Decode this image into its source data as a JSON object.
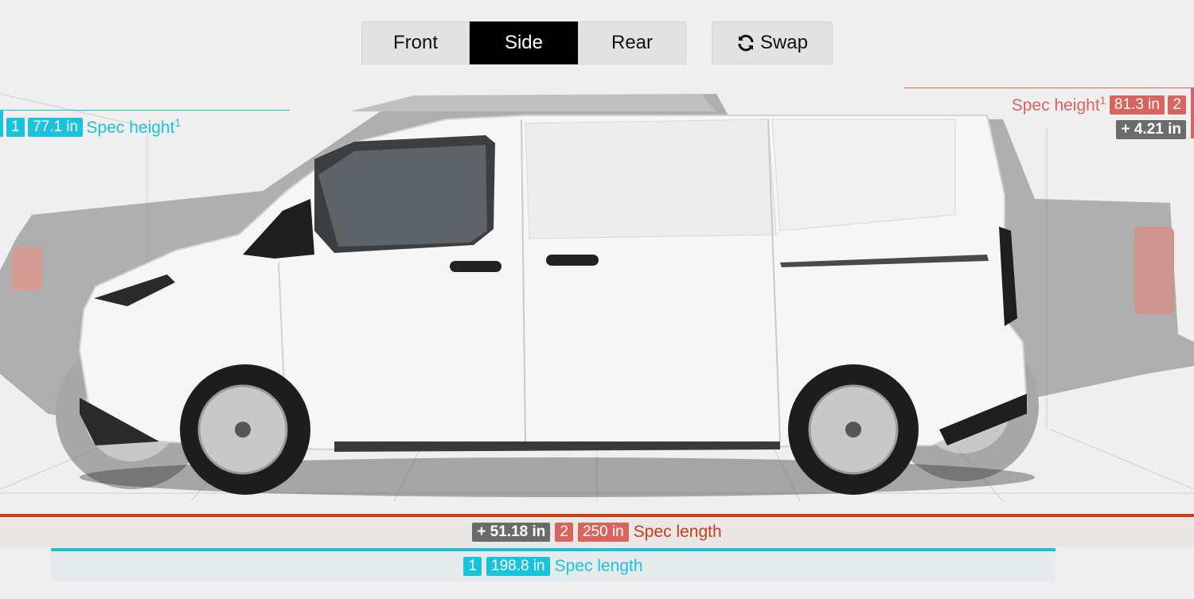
{
  "toolbar": {
    "views": [
      {
        "label": "Front",
        "active": false
      },
      {
        "label": "Side",
        "active": true
      },
      {
        "label": "Rear",
        "active": false
      }
    ],
    "swap_label": "Swap",
    "swap_icon": "refresh-icon"
  },
  "vehicle1": {
    "index": "1",
    "color": "#1ac3dc",
    "height_value": "77.1 in",
    "height_label": "Spec height",
    "height_note": "1",
    "length_value": "198.8 in",
    "length_label": "Spec length"
  },
  "vehicle2": {
    "index": "2",
    "color": "#d9645e",
    "height_value": "81.3 in",
    "height_label": "Spec height",
    "height_note": "1",
    "height_diff": "+ 4.21 in",
    "length_value": "250 in",
    "length_label": "Spec length",
    "length_diff": "+ 51.18 in",
    "length_color": "#cc3b12"
  }
}
